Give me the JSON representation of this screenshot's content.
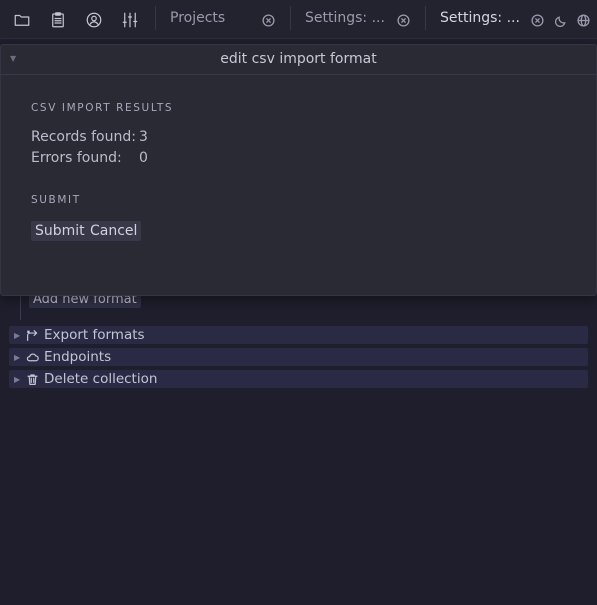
{
  "toolbar": {
    "icons": [
      "folder-icon",
      "clipboard-icon",
      "account-icon",
      "sliders-icon"
    ]
  },
  "tabs": [
    {
      "label": "Projects",
      "active": false
    },
    {
      "label": "Settings: ...",
      "active": false
    },
    {
      "label": "Settings: ...",
      "active": true
    }
  ],
  "top_right_icons": [
    "close-circle-icon",
    "moon-icon",
    "globe-icon"
  ],
  "modal": {
    "title": "edit csv import format",
    "results_heading": "CSV IMPORT RESULTS",
    "records_label": "Records found:",
    "records_value": "3",
    "errors_label": "Errors found:",
    "errors_value": "0",
    "submit_heading": "SUBMIT",
    "submit_label": "Submit",
    "cancel_label": "Cancel"
  },
  "background": {
    "add_format_label": "Add new format",
    "sections": [
      {
        "label": "Export formats",
        "icon": "share-icon"
      },
      {
        "label": "Endpoints",
        "icon": "cloud-icon"
      },
      {
        "label": "Delete collection",
        "icon": "trash-icon"
      }
    ]
  },
  "colors": {
    "background": "#1e1e2c",
    "modal": "#2a2a34",
    "section_row": "#2a2a45"
  }
}
